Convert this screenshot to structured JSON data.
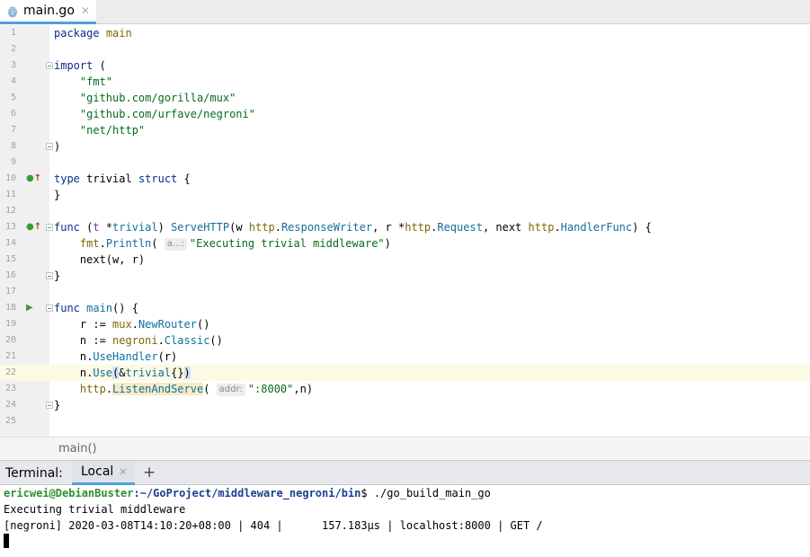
{
  "editor": {
    "tab": {
      "label": "main.go",
      "close_icon": "close-icon",
      "file_icon": "go-gopher-icon"
    },
    "lines": [
      {
        "n": "1",
        "text": "package main"
      },
      {
        "n": "2",
        "text": ""
      },
      {
        "n": "3",
        "text": "import ("
      },
      {
        "n": "4",
        "text": "    \"fmt\""
      },
      {
        "n": "5",
        "text": "    \"github.com/gorilla/mux\""
      },
      {
        "n": "6",
        "text": "    \"github.com/urfave/negroni\""
      },
      {
        "n": "7",
        "text": "    \"net/http\""
      },
      {
        "n": "8",
        "text": ")"
      },
      {
        "n": "9",
        "text": ""
      },
      {
        "n": "10",
        "text": "type trivial struct {"
      },
      {
        "n": "11",
        "text": "}"
      },
      {
        "n": "12",
        "text": ""
      },
      {
        "n": "13",
        "text": "func (t *trivial) ServeHTTP(w http.ResponseWriter, r *http.Request, next http.HandlerFunc) {"
      },
      {
        "n": "14",
        "text": "    fmt.Println( a...: \"Executing trivial middleware\")"
      },
      {
        "n": "15",
        "text": "    next(w, r)"
      },
      {
        "n": "16",
        "text": "}"
      },
      {
        "n": "17",
        "text": ""
      },
      {
        "n": "18",
        "text": "func main() {"
      },
      {
        "n": "19",
        "text": "    r := mux.NewRouter()"
      },
      {
        "n": "20",
        "text": "    n := negroni.Classic()"
      },
      {
        "n": "21",
        "text": "    n.UseHandler(r)"
      },
      {
        "n": "22",
        "text": "    n.Use(&trivial{})"
      },
      {
        "n": "23",
        "text": "    http.ListenAndServe( addr: \":8000\",n)"
      },
      {
        "n": "24",
        "text": "}"
      },
      {
        "n": "25",
        "text": ""
      }
    ],
    "hints": {
      "println": "a...:",
      "listen": "addr:"
    }
  },
  "breadcrumb": {
    "label": "main()"
  },
  "terminal": {
    "title": "Terminal:",
    "tab_label": "Local",
    "add_label": "+",
    "prompt_user": "ericwei@DebianBuster",
    "prompt_path": ":~/GoProject/middleware_negroni/bin",
    "prompt_cmd": "$ ./go_build_main_go",
    "output": [
      "Executing trivial middleware",
      "[negroni] 2020-03-08T14:10:20+08:00 | 404 |      157.183µs | localhost:8000 | GET /"
    ]
  },
  "colors": {
    "tab_accent": "#4f9ee3",
    "current_line": "#fcf9e4",
    "prompt_user": "#2f8f2f",
    "prompt_path": "#1b3f8f"
  }
}
